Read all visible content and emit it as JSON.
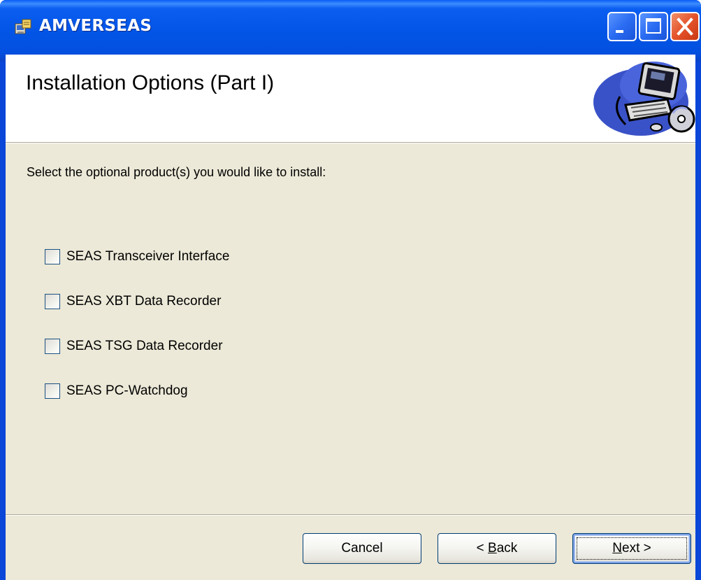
{
  "window": {
    "title": "AMVERSEAS",
    "controls": [
      "minimize-icon",
      "maximize-icon",
      "close-icon"
    ]
  },
  "banner": {
    "title": "Installation Options (Part I)",
    "graphic": "computer-setup-icon"
  },
  "instruction": "Select the optional product(s) you would like to install:",
  "options": [
    {
      "label": "SEAS Transceiver Interface",
      "checked": false
    },
    {
      "label": "SEAS XBT Data Recorder",
      "checked": false
    },
    {
      "label": "SEAS TSG Data Recorder",
      "checked": false
    },
    {
      "label": "SEAS PC-Watchdog",
      "checked": false
    }
  ],
  "buttons": {
    "cancel": "Cancel",
    "back_prefix": "< ",
    "back_mnemonic": "B",
    "back_rest": "ack",
    "next_mnemonic": "N",
    "next_rest": "ext >"
  },
  "colors": {
    "titlebar": "#0255e6",
    "client_bg": "#ece9d8",
    "banner_bg": "#ffffff"
  }
}
